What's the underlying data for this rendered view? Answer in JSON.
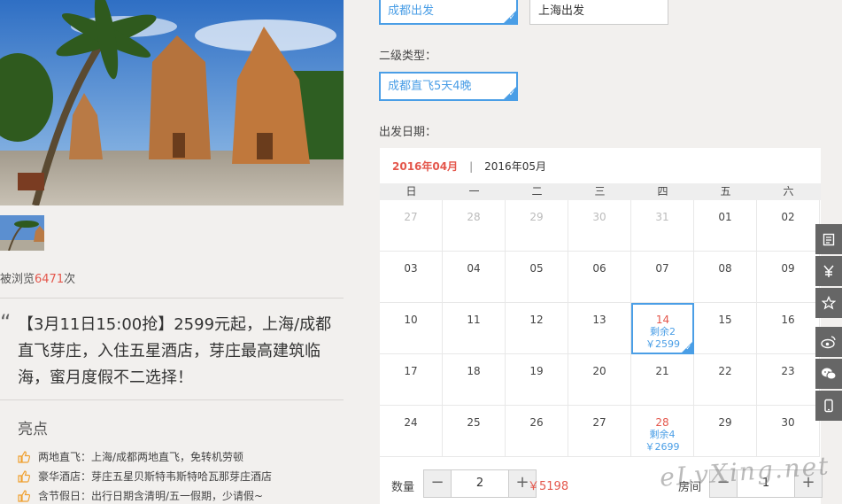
{
  "gallery": {
    "views_prefix": "被浏览",
    "views_count": "6471",
    "views_suffix": "次"
  },
  "product": {
    "quote_mark": "“",
    "title": "【3月11日15:00抢】2599元起，上海/成都直飞芽庄，入住五星酒店，芽庄最高建筑临海，蜜月度假不二选择！"
  },
  "highlights": {
    "title": "亮点",
    "items": [
      "两地直飞：上海/成都两地直飞，免转机劳顿",
      "豪华酒店：芽庄五星贝斯特韦斯特哈瓦那芽庄酒店",
      "含节假日：出行日期含清明/五一假期，少请假~"
    ]
  },
  "options": {
    "departure": [
      "成都出发",
      "上海出发"
    ],
    "subtype_label": "二级类型：",
    "subtype": [
      "成都直飞5天4晚"
    ],
    "date_label": "出发日期："
  },
  "calendar": {
    "months": [
      "2016年04月",
      "2016年05月"
    ],
    "separator": "|",
    "weekdays": [
      "日",
      "一",
      "二",
      "三",
      "四",
      "五",
      "六"
    ],
    "days": [
      {
        "d": "27",
        "dim": true
      },
      {
        "d": "28",
        "dim": true
      },
      {
        "d": "29",
        "dim": true
      },
      {
        "d": "30",
        "dim": true
      },
      {
        "d": "31",
        "dim": true
      },
      {
        "d": "01"
      },
      {
        "d": "02"
      },
      {
        "d": "03"
      },
      {
        "d": "04"
      },
      {
        "d": "05"
      },
      {
        "d": "06"
      },
      {
        "d": "07"
      },
      {
        "d": "08"
      },
      {
        "d": "09"
      },
      {
        "d": "10"
      },
      {
        "d": "11"
      },
      {
        "d": "12"
      },
      {
        "d": "13"
      },
      {
        "d": "14",
        "remain": "剩余2",
        "price": "￥2599",
        "selected": true
      },
      {
        "d": "15"
      },
      {
        "d": "16"
      },
      {
        "d": "17"
      },
      {
        "d": "18"
      },
      {
        "d": "19"
      },
      {
        "d": "20"
      },
      {
        "d": "21"
      },
      {
        "d": "22"
      },
      {
        "d": "23"
      },
      {
        "d": "24"
      },
      {
        "d": "25"
      },
      {
        "d": "26"
      },
      {
        "d": "27"
      },
      {
        "d": "28",
        "remain": "剩余4",
        "price": "￥2699"
      },
      {
        "d": "29"
      },
      {
        "d": "30"
      }
    ]
  },
  "order": {
    "qty_label": "数量",
    "qty_value": "2",
    "total": "￥5198",
    "room_label": "房间",
    "room_value": "1",
    "minus": "−",
    "plus": "+"
  },
  "watermark": "eLvXing.net",
  "colors": {
    "accent": "#4a9ee6",
    "price": "#e4574c"
  }
}
